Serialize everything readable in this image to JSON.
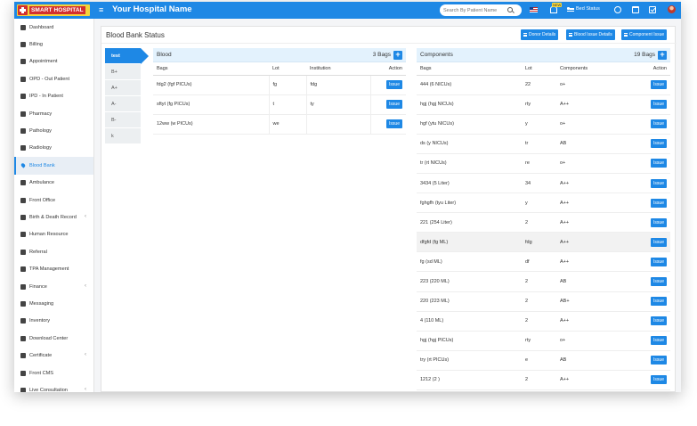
{
  "app": {
    "logo_text": "SMART HOSPITAL",
    "hospital_name": "Your Hospital Name",
    "search_placeholder": "Search By Patient Name",
    "notification_badge": "NEW",
    "bed_status_label": "Bed Status"
  },
  "sidebar": {
    "items": [
      {
        "label": "Dashboard",
        "icon": "monitor-icon",
        "chevron": false
      },
      {
        "label": "Billing",
        "icon": "receipt-icon",
        "chevron": false
      },
      {
        "label": "Appointment",
        "icon": "calendar-icon",
        "chevron": false
      },
      {
        "label": "OPD - Out Patient",
        "icon": "stethoscope-icon",
        "chevron": false
      },
      {
        "label": "IPD - In Patient",
        "icon": "bed-icon",
        "chevron": false
      },
      {
        "label": "Pharmacy",
        "icon": "mortar-pestle-icon",
        "chevron": false
      },
      {
        "label": "Pathology",
        "icon": "flask-icon",
        "chevron": false
      },
      {
        "label": "Radiology",
        "icon": "microscope-icon",
        "chevron": false
      },
      {
        "label": "Blood Bank",
        "icon": "tint-icon",
        "chevron": false
      },
      {
        "label": "Ambulance",
        "icon": "ambulance-icon",
        "chevron": false
      },
      {
        "label": "Front Office",
        "icon": "building-icon",
        "chevron": false
      },
      {
        "label": "Birth & Death Record",
        "icon": "certificate-icon",
        "chevron": true
      },
      {
        "label": "Human Resource",
        "icon": "sitemap-icon",
        "chevron": false
      },
      {
        "label": "Referral",
        "icon": "handshake-icon",
        "chevron": false
      },
      {
        "label": "TPA Management",
        "icon": "umbrella-icon",
        "chevron": false
      },
      {
        "label": "Finance",
        "icon": "money-icon",
        "chevron": true
      },
      {
        "label": "Messaging",
        "icon": "bullhorn-icon",
        "chevron": false
      },
      {
        "label": "Inventory",
        "icon": "box-icon",
        "chevron": false
      },
      {
        "label": "Download Center",
        "icon": "download-icon",
        "chevron": false
      },
      {
        "label": "Certificate",
        "icon": "newspaper-icon",
        "chevron": true
      },
      {
        "label": "Front CMS",
        "icon": "cms-icon",
        "chevron": false
      },
      {
        "label": "Live Consultation",
        "icon": "video-icon",
        "chevron": true
      }
    ],
    "active_index": 8
  },
  "page": {
    "title": "Blood Bank Status",
    "buttons": [
      "Donor Details",
      "Blood Issue Details",
      "Component Issue"
    ]
  },
  "blood_groups": [
    "test",
    "B+",
    "A+",
    "A-",
    "B-",
    "k"
  ],
  "active_group_index": 0,
  "blood_panel": {
    "title": "Blood",
    "count": "3 Bags",
    "columns": [
      "Bags",
      "Lot",
      "Institution",
      "Action"
    ],
    "rows": [
      {
        "bags": "fdg2 (fgf PICUs)",
        "lot": "fg",
        "institution": "fdg",
        "action": "Issue"
      },
      {
        "bags": "sftyt (fg PICUs)",
        "lot": "t",
        "institution": "ty",
        "action": "Issue"
      },
      {
        "bags": "12ww (w PICUs)",
        "lot": "we",
        "institution": "",
        "action": "Issue"
      }
    ]
  },
  "components_panel": {
    "title": "Components",
    "count": "19 Bags",
    "columns": [
      "Bags",
      "Lot",
      "Components",
      "Action"
    ],
    "highlight_row": 10,
    "rows": [
      {
        "bags": "444 (6 NICUs)",
        "lot": "22",
        "component": "o+",
        "action": "Issue"
      },
      {
        "bags": "hgj (hgj NICUs)",
        "lot": "rty",
        "component": "A++",
        "action": "Issue"
      },
      {
        "bags": "hgf (ytu NICUs)",
        "lot": "y",
        "component": "o+",
        "action": "Issue"
      },
      {
        "bags": "ds (y NICUs)",
        "lot": "tr",
        "component": "AB",
        "action": "Issue"
      },
      {
        "bags": "tr (rt NICUs)",
        "lot": "re",
        "component": "o+",
        "action": "Issue"
      },
      {
        "bags": "3434 (5 Liter)",
        "lot": "34",
        "component": "A++",
        "action": "Issue"
      },
      {
        "bags": "fghgfh (tyu Liter)",
        "lot": "y",
        "component": "A++",
        "action": "Issue"
      },
      {
        "bags": "221 (254 Liter)",
        "lot": "2",
        "component": "A++",
        "action": "Issue"
      },
      {
        "bags": "dfgfd (fg ML)",
        "lot": "fdg",
        "component": "A++",
        "action": "Issue"
      },
      {
        "bags": "fg (sd ML)",
        "lot": "df",
        "component": "A++",
        "action": "Issue"
      },
      {
        "bags": "223 (220 ML)",
        "lot": "2",
        "component": "AB",
        "action": "Issue"
      },
      {
        "bags": "220 (223 ML)",
        "lot": "2",
        "component": "AB+",
        "action": "Issue"
      },
      {
        "bags": "4 (110 ML)",
        "lot": "2",
        "component": "A++",
        "action": "Issue"
      },
      {
        "bags": "hgj (hgj PICUs)",
        "lot": "rty",
        "component": "o+",
        "action": "Issue"
      },
      {
        "bags": "try (rt PICUs)",
        "lot": "e",
        "component": "AB",
        "action": "Issue"
      },
      {
        "bags": "1212 (2 )",
        "lot": "2",
        "component": "A++",
        "action": "Issue"
      }
    ]
  },
  "colors": {
    "primary": "#1e88e5",
    "logo_bg": "#f3d43b",
    "logo_red": "#d32f2f",
    "panel_head": "#e3f2fd"
  }
}
